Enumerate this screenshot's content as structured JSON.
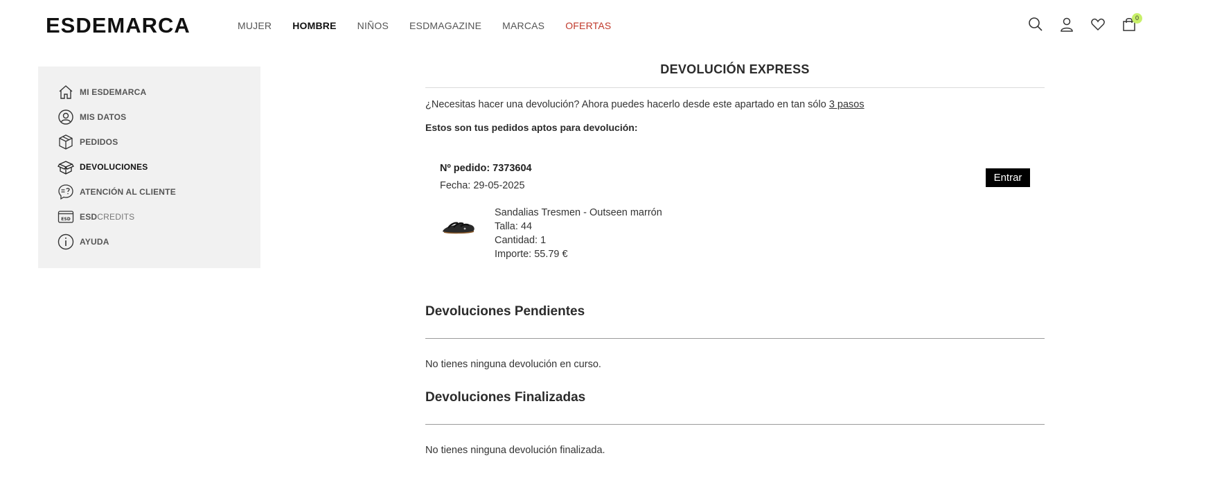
{
  "header": {
    "logo": "ESDEMARCA",
    "nav": [
      {
        "label": "MUJER"
      },
      {
        "label": "HOMBRE"
      },
      {
        "label": "NIÑOS"
      },
      {
        "label": "ESDMAGAZINE"
      },
      {
        "label": "MARCAS"
      },
      {
        "label": "OFERTAS"
      }
    ],
    "active_nav": "HOMBRE",
    "sale_color": "#c0392b",
    "icons": [
      "search-icon",
      "user-icon",
      "heart-icon",
      "cart-icon"
    ],
    "cart_count": "0",
    "cart_badge_color": "#c8f06a"
  },
  "sidebar": {
    "background": "#f1f1f1",
    "items": [
      {
        "label": "MI ESDEMARCA",
        "icon": "home-icon"
      },
      {
        "label": "MIS DATOS",
        "icon": "user-circle-icon"
      },
      {
        "label": "PEDIDOS",
        "icon": "box-icon"
      },
      {
        "label": "DEVOLUCIONES",
        "icon": "open-box-icon",
        "active": true
      },
      {
        "label": "ATENCIÓN AL CLIENTE",
        "icon": "chat-question-icon"
      },
      {
        "label_bold": "ESD",
        "label_light": "CREDITS",
        "icon": "esd-card-icon",
        "icon_text": "ESD"
      },
      {
        "label": "AYUDA",
        "icon": "info-icon"
      }
    ]
  },
  "main": {
    "title": "DEVOLUCIÓN EXPRESS",
    "intro_text": "¿Necesitas hacer una devolución? Ahora puedes hacerlo desde este apartado en tan sólo ",
    "intro_link": "3 pasos",
    "subhead": "Estos son tus pedidos aptos para devolución:",
    "order": {
      "number": "Nº pedido: 7373604",
      "date": "Fecha: 29-05-2025",
      "enter_label": "Entrar",
      "product": {
        "name": "Sandalias Tresmen - Outseen marrón",
        "size": "Talla: 44",
        "quantity": "Cantidad: 1",
        "amount": "Importe: 55.79 €"
      }
    },
    "pending": {
      "title": "Devoluciones Pendientes",
      "text": "No tienes ninguna devolución en curso."
    },
    "finished": {
      "title": "Devoluciones Finalizadas",
      "text": "No tienes ninguna devolución finalizada."
    }
  }
}
